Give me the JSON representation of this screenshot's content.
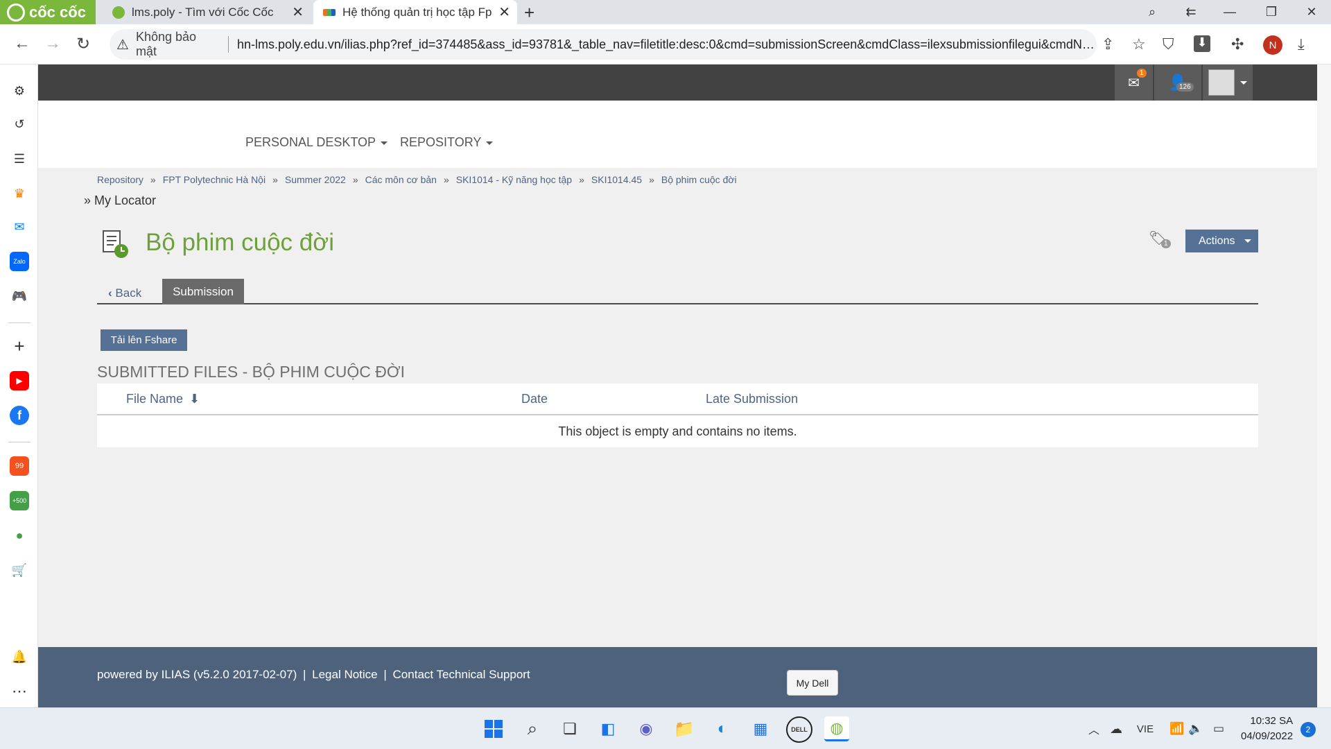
{
  "browser": {
    "brand": "cốc cốc",
    "tabs": [
      {
        "title": "lms.poly - Tìm với Cốc Cốc",
        "active": false
      },
      {
        "title": "Hệ thống quản trị học tập Fp",
        "active": true
      }
    ],
    "address": {
      "security_label": "Không bảo mật",
      "url": "hn-lms.poly.edu.vn/ilias.php?ref_id=374485&ass_id=93781&_table_nav=filetitle:desc:0&cmd=submissionScreen&cmdClass=ilexsubmissionfilegui&cmdNode=..."
    },
    "profile_initial": "N"
  },
  "topbar": {
    "mail_badge": "1",
    "users_badge": "126"
  },
  "mainnav": {
    "items": [
      {
        "label": "PERSONAL DESKTOP"
      },
      {
        "label": "REPOSITORY"
      }
    ]
  },
  "breadcrumb": {
    "items": [
      "Repository",
      "FPT Polytechnic Hà Nội",
      "Summer 2022",
      "Các môn cơ bản",
      "SKI1014 - Kỹ năng học tập",
      "SKI1014.45",
      "Bộ phim cuộc đời"
    ],
    "separator": "»",
    "locator": "» My Locator"
  },
  "header": {
    "title": "Bộ phim cuộc đời",
    "tag_count": "1",
    "actions_label": "Actions"
  },
  "tabs": {
    "back_label": "Back",
    "submission_label": "Submission"
  },
  "toolbar": {
    "upload_label": "Tải lên Fshare"
  },
  "submitted": {
    "section_title": "SUBMITTED FILES - BỘ PHIM CUỘC ĐỜI",
    "columns": [
      "File Name",
      "Date",
      "Late Submission"
    ],
    "empty_message": "This object is empty and contains no items."
  },
  "footer": {
    "powered": "powered by ILIAS (v5.2.0 2017-02-07)",
    "sep": "|",
    "legal": "Legal Notice",
    "support": "Contact Technical Support"
  },
  "tooltip": {
    "text": "My Dell"
  },
  "taskbar": {
    "lang": "VIE",
    "time": "10:32 SA",
    "date": "04/09/2022",
    "notifications": "2"
  },
  "colors": {
    "accent_green": "#6ea03c",
    "brand_green": "#7ab73b",
    "button_blue": "#557196",
    "link_blue": "#4c6586",
    "footer_bg": "#4f627c",
    "topbar_bg": "#424242"
  }
}
